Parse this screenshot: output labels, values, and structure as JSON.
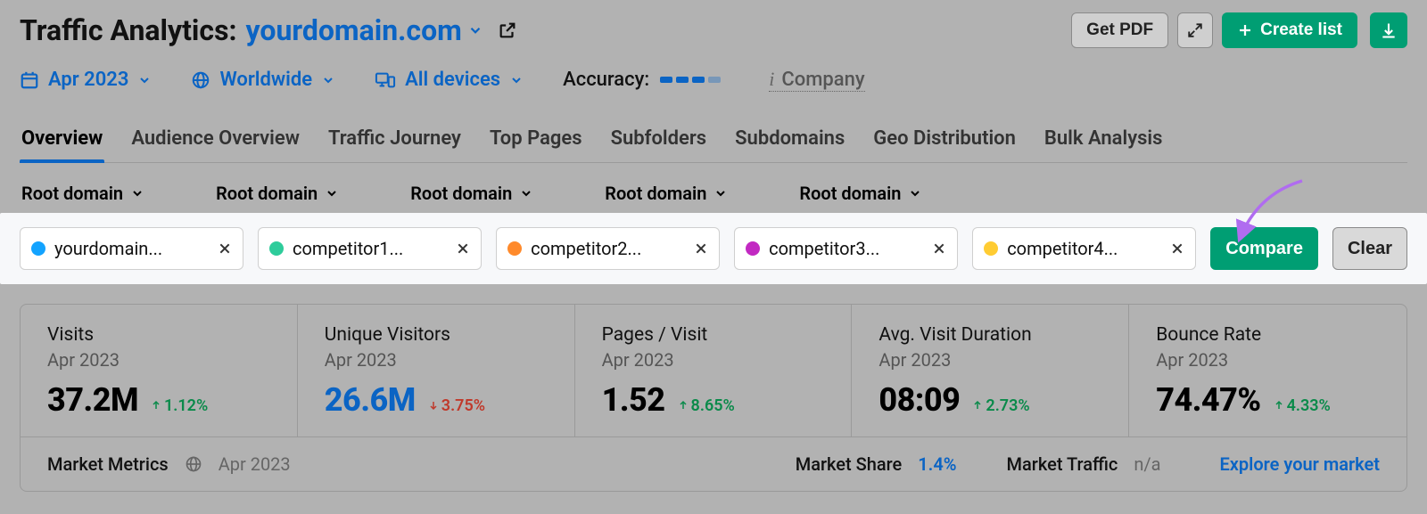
{
  "header": {
    "title_static": "Traffic Analytics:",
    "domain": "yourdomain.com",
    "actions": {
      "get_pdf": "Get PDF",
      "create_list": "Create list"
    }
  },
  "filters": {
    "date": "Apr 2023",
    "region": "Worldwide",
    "devices": "All devices",
    "accuracy_label": "Accuracy:",
    "company_label": "Company"
  },
  "tabs": [
    {
      "label": "Overview",
      "active": true
    },
    {
      "label": "Audience Overview",
      "active": false
    },
    {
      "label": "Traffic Journey",
      "active": false
    },
    {
      "label": "Top Pages",
      "active": false
    },
    {
      "label": "Subfolders",
      "active": false
    },
    {
      "label": "Subdomains",
      "active": false
    },
    {
      "label": "Geo Distribution",
      "active": false
    },
    {
      "label": "Bulk Analysis",
      "active": false
    }
  ],
  "root_selectors": [
    "Root domain",
    "Root domain",
    "Root domain",
    "Root domain",
    "Root domain"
  ],
  "compare": {
    "chips": [
      {
        "label": "yourdomain...",
        "color": "#13a3ff"
      },
      {
        "label": "competitor1...",
        "color": "#2ecc9b"
      },
      {
        "label": "competitor2...",
        "color": "#ff8a2b"
      },
      {
        "label": "competitor3...",
        "color": "#c229c2"
      },
      {
        "label": "competitor4...",
        "color": "#ffcc33"
      }
    ],
    "compare_btn": "Compare",
    "clear_btn": "Clear"
  },
  "metrics": [
    {
      "title": "Visits",
      "period": "Apr 2023",
      "value": "37.2M",
      "delta": "1.12%",
      "dir": "up",
      "link": false
    },
    {
      "title": "Unique Visitors",
      "period": "Apr 2023",
      "value": "26.6M",
      "delta": "3.75%",
      "dir": "down",
      "link": true
    },
    {
      "title": "Pages / Visit",
      "period": "Apr 2023",
      "value": "1.52",
      "delta": "8.65%",
      "dir": "up",
      "link": false
    },
    {
      "title": "Avg. Visit Duration",
      "period": "Apr 2023",
      "value": "08:09",
      "delta": "2.73%",
      "dir": "up",
      "link": false
    },
    {
      "title": "Bounce Rate",
      "period": "Apr 2023",
      "value": "74.47%",
      "delta": "4.33%",
      "dir": "up",
      "link": false
    }
  ],
  "market": {
    "label": "Market Metrics",
    "period": "Apr 2023",
    "share_label": "Market Share",
    "share_value": "1.4%",
    "traffic_label": "Market Traffic",
    "traffic_value": "n/a",
    "explore": "Explore your market"
  }
}
